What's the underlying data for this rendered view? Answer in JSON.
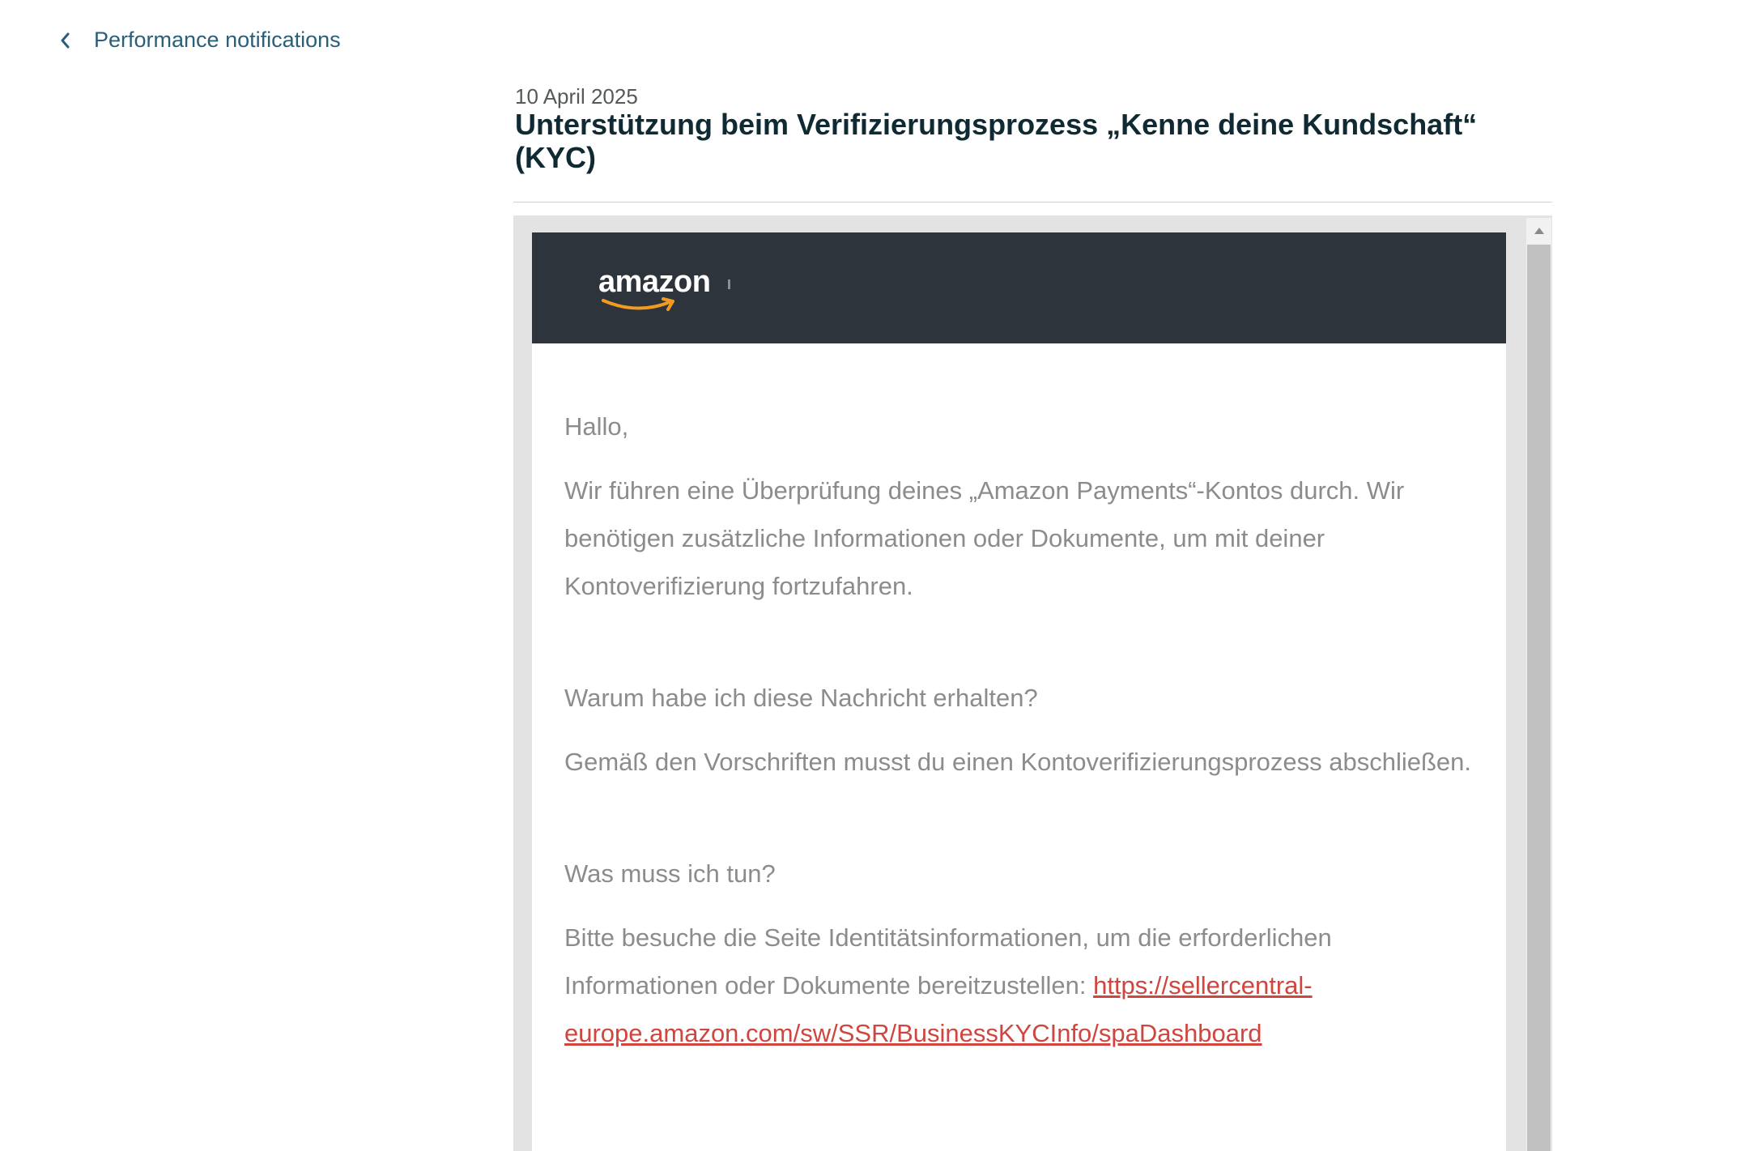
{
  "nav": {
    "back_label": "Performance notifications",
    "back_icon": "chevron-left-icon"
  },
  "notification": {
    "date": "10 April 2025",
    "title": "Unterstützung beim Verifizierungsprozess „Kenne deine Kundschaft“ (KYC)"
  },
  "email": {
    "logo_text": "amazon",
    "logo_icon": "amazon-smile-icon",
    "colors": {
      "header_bg": "#2e343c",
      "link": "#d0463e",
      "body_text": "#8c8c8c",
      "smile": "#f39a20"
    },
    "greeting": "Hallo,",
    "intro": "Wir führen eine Überprüfung deines „Amazon Payments“-Kontos durch. Wir benötigen zusätzliche Informationen oder Dokumente, um mit deiner Kontoverifizierung fortzufahren.",
    "why_heading": "Warum habe ich diese Nachricht erhalten?",
    "why_text": "Gemäß den Vorschriften musst du einen Kontoverifizierungsprozess abschließen.",
    "todo_heading": "Was muss ich tun?",
    "todo_text": "Bitte besuche die Seite Identitätsinformationen, um die erforderlichen Informationen oder Dokumente bereitzustellen: ",
    "todo_link": "https://sellercentral-europe.amazon.com/sw/SSR/BusinessKYCInfo/spaDashboard"
  },
  "scrollbar": {
    "up_icon": "scroll-up-arrow-icon"
  }
}
